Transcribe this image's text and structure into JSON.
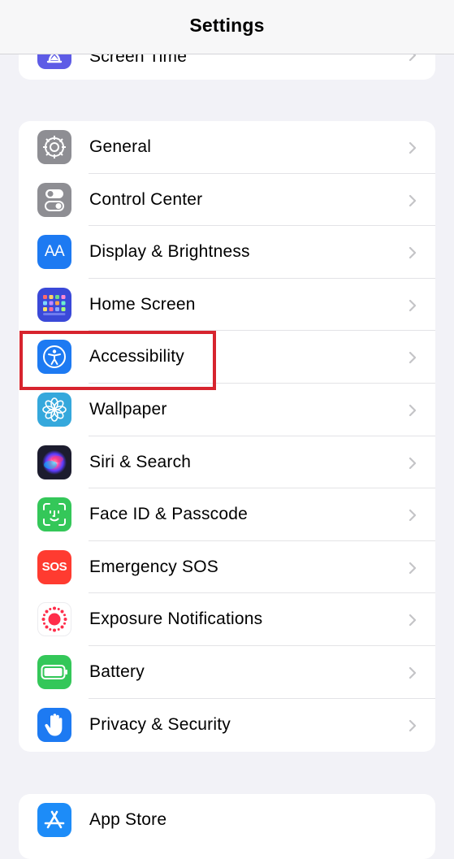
{
  "nav": {
    "title": "Settings"
  },
  "top_group": {
    "items": [
      {
        "label": "Screen Time",
        "icon": "hourglass-icon",
        "color": "#5e5ce6"
      }
    ]
  },
  "main_group": {
    "items": [
      {
        "label": "General",
        "icon": "gear-icon",
        "color": "#8e8e93"
      },
      {
        "label": "Control Center",
        "icon": "toggles-icon",
        "color": "#8e8e93"
      },
      {
        "label": "Display & Brightness",
        "icon": "text-size-icon",
        "icon_text": "AA",
        "color": "#1d7af2"
      },
      {
        "label": "Home Screen",
        "icon": "app-grid-icon",
        "color": "#3a49d8"
      },
      {
        "label": "Accessibility",
        "icon": "accessibility-icon",
        "color": "#1d7af2"
      },
      {
        "label": "Wallpaper",
        "icon": "flower-icon",
        "color": "#35a8dc"
      },
      {
        "label": "Siri & Search",
        "icon": "siri-icon",
        "color": "#1c1c2e"
      },
      {
        "label": "Face ID & Passcode",
        "icon": "face-id-icon",
        "color": "#34c759"
      },
      {
        "label": "Emergency SOS",
        "icon": "sos-icon",
        "icon_text": "SOS",
        "color": "#ff3b30"
      },
      {
        "label": "Exposure Notifications",
        "icon": "exposure-icon",
        "color": "#ffffff"
      },
      {
        "label": "Battery",
        "icon": "battery-icon",
        "color": "#34c759"
      },
      {
        "label": "Privacy & Security",
        "icon": "hand-icon",
        "color": "#1d7af2"
      }
    ]
  },
  "store_group": {
    "items": [
      {
        "label": "App Store",
        "icon": "app-store-icon",
        "color": "#1d8cf8"
      }
    ]
  },
  "highlight": {
    "target": "Accessibility",
    "color": "#d7242e"
  }
}
